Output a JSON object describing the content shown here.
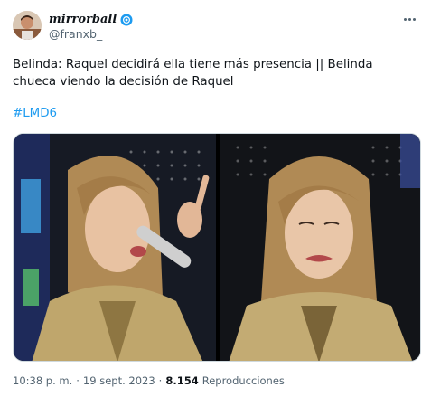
{
  "author": {
    "display_name": "mirrorball",
    "handle": "@franxb_",
    "avatar_icon": "profile-avatar"
  },
  "tweet": {
    "text": "Belinda: Raquel decidirá ella tiene más presencia || Belinda chueca viendo la decisión de Raquel",
    "hashtag": "#LMD6",
    "time": "10:38 p. m.",
    "separator": "·",
    "date": "19 sept. 2023",
    "separator2": "·",
    "views_count": "8.154",
    "views_label": "Reproducciones"
  },
  "colors": {
    "link": "#1d9bf0",
    "verified": "#1d9bf0",
    "secondary_text": "#536471"
  },
  "icons": {
    "verified": "verified-badge-icon",
    "more": "more-options-icon"
  }
}
